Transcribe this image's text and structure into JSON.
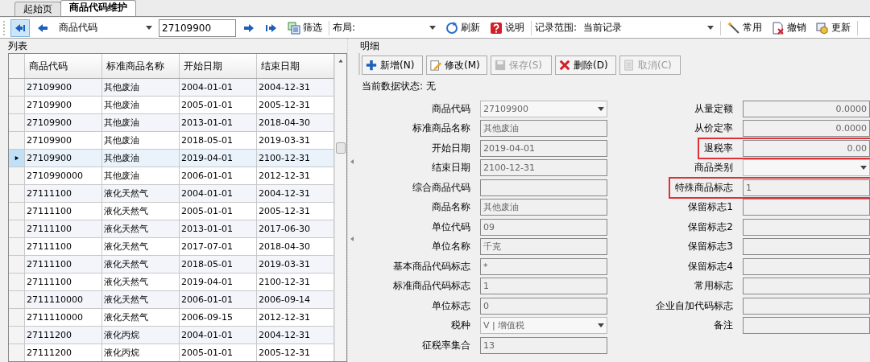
{
  "tabs": [
    {
      "label": "起始页",
      "selected": false
    },
    {
      "label": "商品代码维护",
      "selected": true
    }
  ],
  "toolbar": {
    "nav_back": [
      {
        "kind": "first",
        "selected": true
      },
      {
        "kind": "prev",
        "selected": false
      }
    ],
    "search_field": {
      "value": "商品代码"
    },
    "search_value": "27109900",
    "nav_forward": [
      {
        "kind": "next"
      },
      {
        "kind": "last"
      }
    ],
    "items": [
      {
        "kind": "filter",
        "label": "筛选"
      },
      {
        "kind": "layout",
        "label": "布局:",
        "value": ""
      },
      {
        "kind": "refresh",
        "label": "刷新"
      },
      {
        "kind": "help",
        "label": "说明"
      },
      {
        "kind": "range",
        "label": "记录范围:",
        "value": "当前记录"
      },
      {
        "kind": "common",
        "label": "常用"
      },
      {
        "kind": "undo",
        "label": "撤销"
      },
      {
        "kind": "update",
        "label": "更新"
      }
    ]
  },
  "list_panel": {
    "title": "列表",
    "columns": [
      "商品代码",
      "标准商品名称",
      "开始日期",
      "结束日期"
    ],
    "rows": [
      {
        "cells": [
          "27109900",
          "其他废油",
          "2004-01-01",
          "2004-12-31"
        ],
        "selected": false
      },
      {
        "cells": [
          "27109900",
          "其他废油",
          "2005-01-01",
          "2005-12-31"
        ],
        "selected": false
      },
      {
        "cells": [
          "27109900",
          "其他废油",
          "2013-01-01",
          "2018-04-30"
        ],
        "selected": false
      },
      {
        "cells": [
          "27109900",
          "其他废油",
          "2018-05-01",
          "2019-03-31"
        ],
        "selected": false
      },
      {
        "cells": [
          "27109900",
          "其他废油",
          "2019-04-01",
          "2100-12-31"
        ],
        "selected": true
      },
      {
        "cells": [
          "2710990000",
          "其他废油",
          "2006-01-01",
          "2012-12-31"
        ],
        "selected": false
      },
      {
        "cells": [
          "27111100",
          "液化天然气",
          "2004-01-01",
          "2004-12-31"
        ],
        "selected": false
      },
      {
        "cells": [
          "27111100",
          "液化天然气",
          "2005-01-01",
          "2005-12-31"
        ],
        "selected": false
      },
      {
        "cells": [
          "27111100",
          "液化天然气",
          "2013-01-01",
          "2017-06-30"
        ],
        "selected": false
      },
      {
        "cells": [
          "27111100",
          "液化天然气",
          "2017-07-01",
          "2018-04-30"
        ],
        "selected": false
      },
      {
        "cells": [
          "27111100",
          "液化天然气",
          "2018-05-01",
          "2019-03-31"
        ],
        "selected": false
      },
      {
        "cells": [
          "27111100",
          "液化天然气",
          "2019-04-01",
          "2100-12-31"
        ],
        "selected": false
      },
      {
        "cells": [
          "2711110000",
          "液化天然气",
          "2006-01-01",
          "2006-09-14"
        ],
        "selected": false
      },
      {
        "cells": [
          "2711110000",
          "液化天然气",
          "2006-09-15",
          "2012-12-31"
        ],
        "selected": false
      },
      {
        "cells": [
          "27111200",
          "液化丙烷",
          "2004-01-01",
          "2004-12-31"
        ],
        "selected": false
      },
      {
        "cells": [
          "27111200",
          "液化丙烷",
          "2005-01-01",
          "2005-12-31"
        ],
        "selected": false
      }
    ]
  },
  "detail_panel": {
    "title": "明细",
    "buttons": [
      {
        "kind": "add",
        "label": "新增(N)",
        "disabled": false
      },
      {
        "kind": "edit",
        "label": "修改(M)",
        "disabled": false
      },
      {
        "kind": "save",
        "label": "保存(S)",
        "disabled": true
      },
      {
        "kind": "delete",
        "label": "删除(D)",
        "disabled": false
      },
      {
        "kind": "cancel",
        "label": "取消(C)",
        "disabled": true
      }
    ],
    "status": "当前数据状态: 无",
    "left_fields": [
      {
        "label": "商品代码",
        "kind": "combo",
        "value": "27109900",
        "highlighted": false
      },
      {
        "label": "标准商品名称",
        "kind": "text",
        "value": "其他废油",
        "highlighted": false
      },
      {
        "label": "开始日期",
        "kind": "text",
        "value": "2019-04-01",
        "highlighted": false
      },
      {
        "label": "结束日期",
        "kind": "text",
        "value": "2100-12-31",
        "highlighted": false
      },
      {
        "label": "综合商品代码",
        "kind": "text",
        "highlighted": false
      },
      {
        "label": "商品名称",
        "kind": "text",
        "value": "其他废油",
        "highlighted": false
      },
      {
        "label": "单位代码",
        "kind": "text",
        "value": "09",
        "highlighted": false
      },
      {
        "label": "单位名称",
        "kind": "text",
        "value": "千克",
        "highlighted": false
      },
      {
        "label": "基本商品代码标志",
        "kind": "text",
        "value": "*",
        "highlighted": false
      },
      {
        "label": "标准商品代码标志",
        "kind": "text",
        "value": "1",
        "highlighted": false
      },
      {
        "label": "单位标志",
        "kind": "text",
        "value": "0",
        "highlighted": false
      },
      {
        "label": "税种",
        "kind": "combo",
        "value": "V | 增值税",
        "highlighted": false
      },
      {
        "label": "征税率集合",
        "kind": "text",
        "value": "13",
        "highlighted": false
      }
    ],
    "right_fields": [
      {
        "label": "从量定额",
        "kind": "number",
        "value": "0.0000",
        "highlighted": false
      },
      {
        "label": "从价定率",
        "kind": "number",
        "value": "0.0000",
        "highlighted": false
      },
      {
        "label": "退税率",
        "kind": "number",
        "value": "0.00",
        "highlighted": true
      },
      {
        "label": "商品类别",
        "kind": "combo",
        "highlighted": false
      },
      {
        "label": "特殊商品标志",
        "kind": "text",
        "value": "1",
        "highlighted": true
      },
      {
        "label": "保留标志1",
        "kind": "text",
        "highlighted": false
      },
      {
        "label": "保留标志2",
        "kind": "text",
        "highlighted": false
      },
      {
        "label": "保留标志3",
        "kind": "text",
        "highlighted": false
      },
      {
        "label": "保留标志4",
        "kind": "text",
        "highlighted": false
      },
      {
        "label": "常用标志",
        "kind": "text",
        "highlighted": false
      },
      {
        "label": "企业自加代码标志",
        "kind": "text",
        "highlighted": false
      },
      {
        "label": "备注",
        "kind": "text",
        "highlighted": false
      }
    ]
  }
}
